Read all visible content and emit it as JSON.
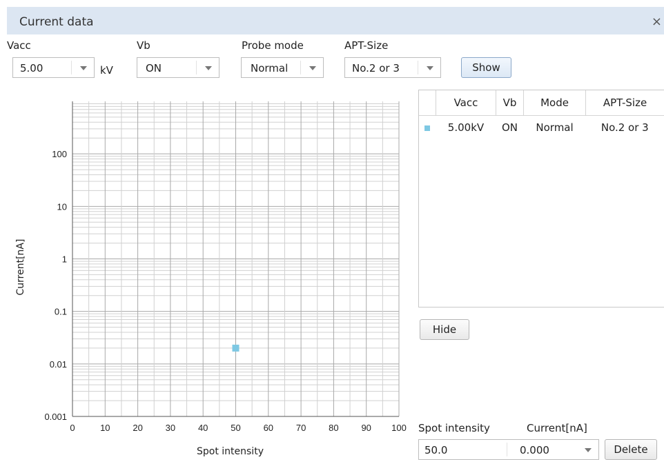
{
  "window": {
    "title": "Current data",
    "close_glyph": "×"
  },
  "controls": {
    "vacc": {
      "label": "Vacc",
      "value": "5.00",
      "unit": "kV"
    },
    "vb": {
      "label": "Vb",
      "value": "ON"
    },
    "probe_mode": {
      "label": "Probe mode",
      "value": "Normal"
    },
    "apt_size": {
      "label": "APT-Size",
      "value": "No.2 or 3"
    },
    "show_label": "Show"
  },
  "table": {
    "columns": [
      "Vacc",
      "Vb",
      "Mode",
      "APT-Size"
    ],
    "rows": [
      {
        "vacc": "5.00kV",
        "vb": "ON",
        "mode": "Normal",
        "apt": "No.2 or 3"
      }
    ],
    "marker_color": "#7ec8e3"
  },
  "hide_label": "Hide",
  "entry": {
    "spot_label": "Spot intensity",
    "current_label": "Current[nA]",
    "spot_value": "50.0",
    "current_value": "0.000",
    "delete_label": "Delete"
  },
  "chart_data": {
    "type": "scatter",
    "xlabel": "Spot intensity",
    "ylabel": "Current[nA]",
    "xlim": [
      0,
      100
    ],
    "ylim": [
      0.001,
      1000
    ],
    "yscale": "log",
    "x_ticks": [
      0,
      10,
      20,
      30,
      40,
      50,
      60,
      70,
      80,
      90,
      100
    ],
    "y_ticks": [
      "0.001",
      "0.01",
      "0.1",
      "1",
      "10",
      "100"
    ],
    "grid": true,
    "points": [
      {
        "x": 50,
        "y": 0.02
      }
    ],
    "marker_color": "#7ec8e3"
  }
}
